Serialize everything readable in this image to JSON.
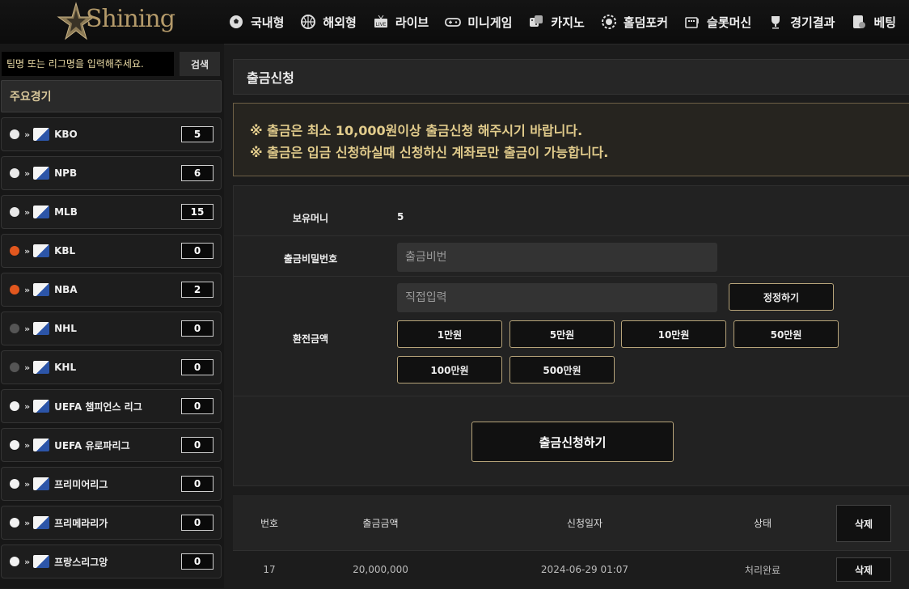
{
  "header": {
    "logo_text": "Shining",
    "nav": [
      {
        "label": "국내형",
        "icon": "soccer-ball-icon"
      },
      {
        "label": "해외형",
        "icon": "basketball-icon"
      },
      {
        "label": "라이브",
        "icon": "live-tv-icon"
      },
      {
        "label": "미니게임",
        "icon": "gamepad-icon"
      },
      {
        "label": "카지노",
        "icon": "dice-icon"
      },
      {
        "label": "홀덤포커",
        "icon": "poker-chip-icon"
      },
      {
        "label": "슬롯머신",
        "icon": "slot-machine-icon"
      },
      {
        "label": "경기결과",
        "icon": "trophy-icon"
      },
      {
        "label": "베팅",
        "icon": "betting-slip-icon"
      }
    ]
  },
  "sidebar": {
    "search": {
      "placeholder": "팀명 또는 리그명을 입력해주세요.",
      "button": "검색"
    },
    "section_title": "주요경기",
    "leagues": [
      {
        "name": "KBO",
        "count": "5",
        "sport_color": "#e8e8e8"
      },
      {
        "name": "NPB",
        "count": "6",
        "sport_color": "#e8e8e8"
      },
      {
        "name": "MLB",
        "count": "15",
        "sport_color": "#e8e8e8"
      },
      {
        "name": "KBL",
        "count": "0",
        "sport_color": "#e2571e"
      },
      {
        "name": "NBA",
        "count": "2",
        "sport_color": "#e2571e"
      },
      {
        "name": "NHL",
        "count": "0",
        "sport_color": "#555555"
      },
      {
        "name": "KHL",
        "count": "0",
        "sport_color": "#555555"
      },
      {
        "name": "UEFA 챔피언스 리그",
        "count": "0",
        "sport_color": "#f2f2f2"
      },
      {
        "name": "UEFA 유로파리그",
        "count": "0",
        "sport_color": "#f2f2f2"
      },
      {
        "name": "프리미어리그",
        "count": "0",
        "sport_color": "#f2f2f2"
      },
      {
        "name": "프리메라리가",
        "count": "0",
        "sport_color": "#f2f2f2"
      },
      {
        "name": "프랑스리그앙",
        "count": "0",
        "sport_color": "#f2f2f2"
      }
    ]
  },
  "main": {
    "title": "출금신청",
    "notice": [
      "※ 출금은 최소 10,000원이상 출금신청 해주시기 바랍니다.",
      "※ 출금은 입금 신청하실때 신청하신 계좌로만 출금이 가능합니다."
    ],
    "form": {
      "balance_label": "보유머니",
      "balance_value": "5",
      "password_label": "출금비밀번호",
      "password_placeholder": "출금비번",
      "amount_label": "환전금액",
      "amount_placeholder": "직접입력",
      "reset_button": "정정하기",
      "quick_amounts": [
        "1만원",
        "5만원",
        "10만원",
        "50만원",
        "100만원",
        "500만원"
      ],
      "submit_button": "출금신청하기"
    },
    "history": {
      "headers": {
        "no": "번호",
        "amount": "출금금액",
        "date": "신청일자",
        "status": "상태",
        "action": "삭제"
      },
      "rows": [
        {
          "no": "17",
          "amount": "20,000,000",
          "date": "2024-06-29 01:07",
          "status": "처리완료",
          "action": "삭제"
        }
      ]
    }
  },
  "colors": {
    "accent": "#b7a47a",
    "notice_text": "#e2cc8c",
    "background": "#1c1c1c"
  }
}
